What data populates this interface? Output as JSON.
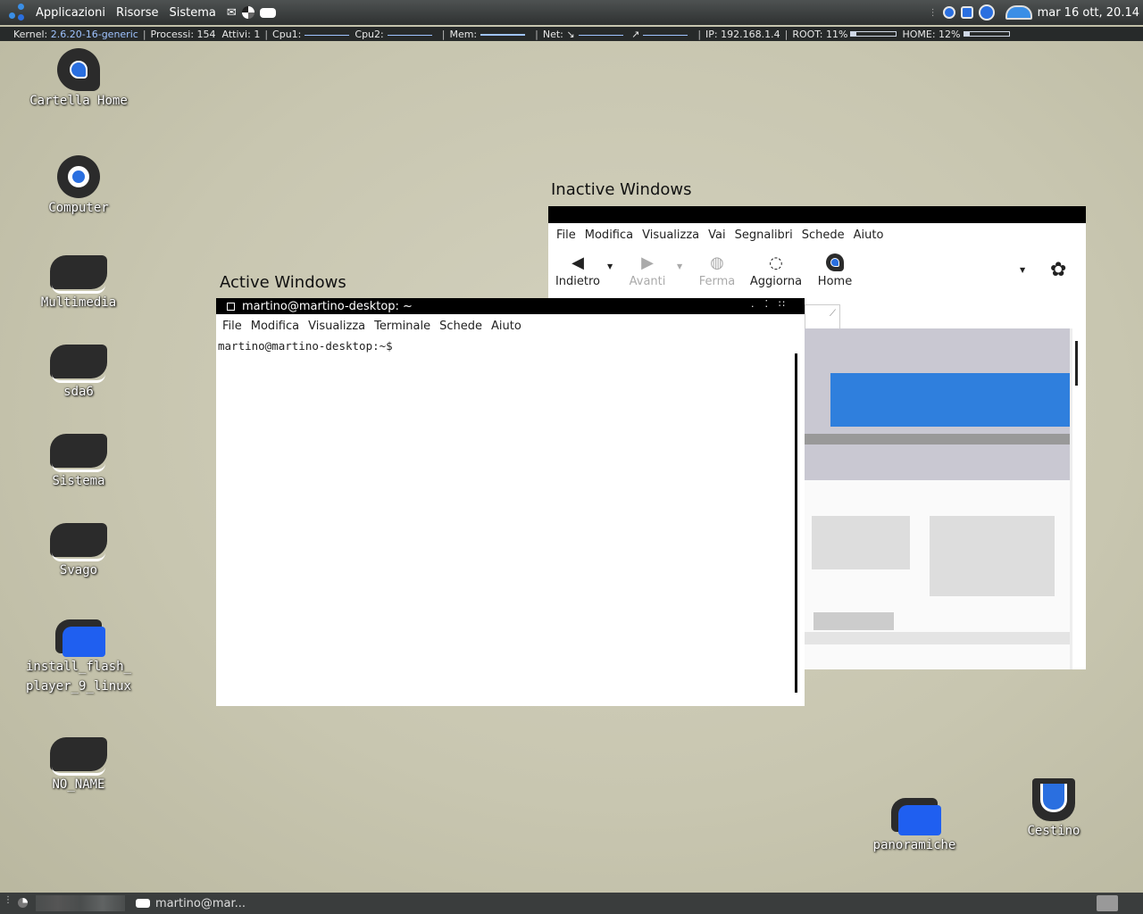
{
  "top_panel": {
    "menus": [
      "Applicazioni",
      "Risorse",
      "Sistema"
    ],
    "clock": "mar 16 ott, 20.14"
  },
  "conky": {
    "kernel_label": "Kernel:",
    "kernel": "2.6.20-16-generic",
    "processes_label": "Processi:",
    "processes": "154",
    "active_label": "Attivi:",
    "active": "1",
    "cpu1_label": "Cpu1:",
    "cpu2_label": "Cpu2:",
    "mem_label": "Mem:",
    "net_label": "Net:",
    "down_arrow": "↘",
    "up_arrow": "↗",
    "ip_label": "IP:",
    "ip": "192.168.1.4",
    "root_label": "ROOT:",
    "root": "11%",
    "root_fraction": 0.11,
    "home_label": "HOME:",
    "home": "12%",
    "home_fraction": 0.12
  },
  "desktop": {
    "icons": [
      {
        "label": "Cartella Home",
        "icon": "home-folder-icon"
      },
      {
        "label": "Computer",
        "icon": "computer-icon"
      },
      {
        "label": "Multimedia",
        "icon": "drive-icon"
      },
      {
        "label": "sda6",
        "icon": "drive-icon"
      },
      {
        "label": "Sistema",
        "icon": "drive-icon"
      },
      {
        "label": "Svago",
        "icon": "drive-icon"
      },
      {
        "label": "install_flash_\nplayer_9_linux",
        "icon": "file-icon"
      },
      {
        "label": "NO_NAME",
        "icon": "drive-icon"
      },
      {
        "label": "panoramiche",
        "icon": "file-icon"
      },
      {
        "label": "Cestino",
        "icon": "trash-icon"
      }
    ]
  },
  "headings": {
    "inactive": "Inactive Windows",
    "active": "Active Windows"
  },
  "browser": {
    "menu": [
      "File",
      "Modifica",
      "Visualizza",
      "Vai",
      "Segnalibri",
      "Schede",
      "Aiuto"
    ],
    "toolbar": {
      "back": "Indietro",
      "forward": "Avanti",
      "stop": "Ferma",
      "reload": "Aggiorna",
      "home": "Home"
    }
  },
  "terminal": {
    "title": "martino@martino-desktop: ~",
    "menu": [
      "File",
      "Modifica",
      "Visualizza",
      "Terminale",
      "Schede",
      "Aiuto"
    ],
    "prompt": "martino@martino-desktop:~$"
  },
  "bottom_panel": {
    "task_label": "martino@mar..."
  }
}
